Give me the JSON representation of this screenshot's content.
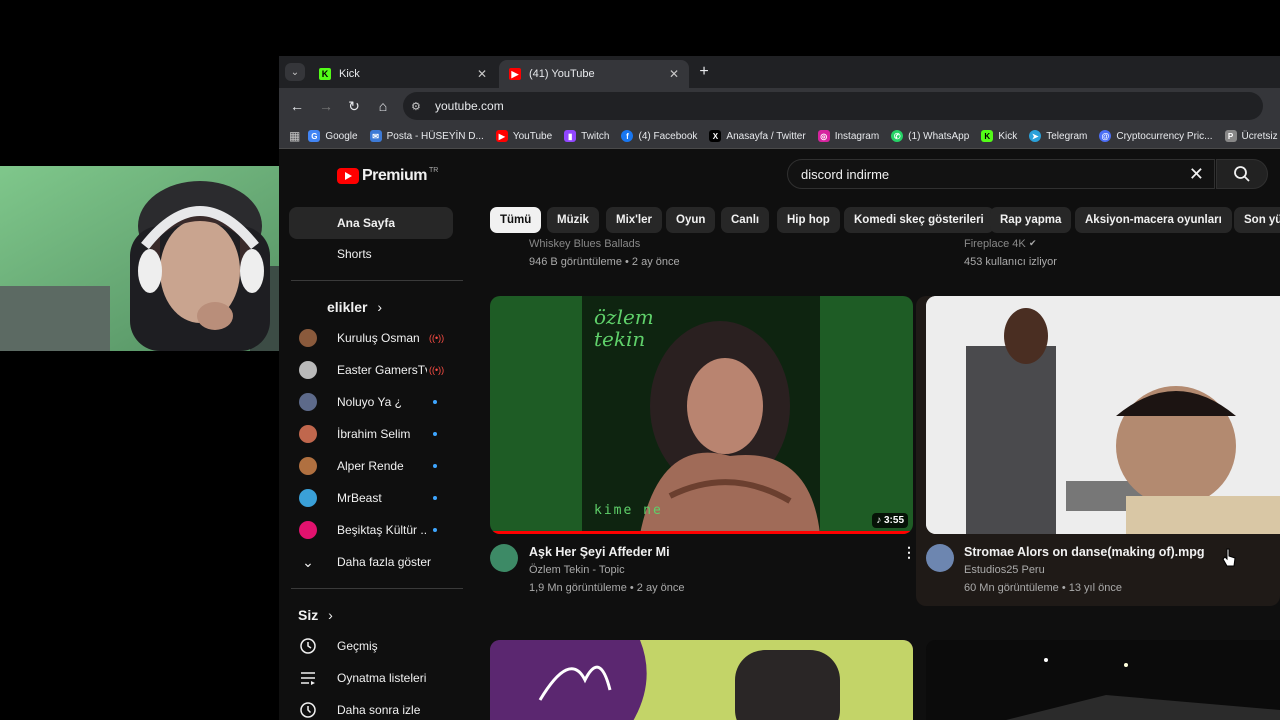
{
  "tabs": [
    {
      "title": "Kick",
      "favicon": "kick-icon",
      "active": false
    },
    {
      "title": "(41) YouTube",
      "favicon": "youtube-icon",
      "active": true
    }
  ],
  "address": {
    "url": "youtube.com"
  },
  "bookmarks": [
    {
      "label": "Google",
      "icon": "google-icon",
      "color": "#4285f4"
    },
    {
      "label": "Posta - HÜSEYİN D...",
      "icon": "mail-icon",
      "color": "#3d7ad6"
    },
    {
      "label": "YouTube",
      "icon": "youtube-icon",
      "color": "#ff0000"
    },
    {
      "label": "Twitch",
      "icon": "twitch-icon",
      "color": "#9146ff"
    },
    {
      "label": "(4) Facebook",
      "icon": "facebook-icon",
      "color": "#1877f2"
    },
    {
      "label": "Anasayfa / Twitter",
      "icon": "x-icon",
      "color": "#000000"
    },
    {
      "label": "Instagram",
      "icon": "instagram-icon",
      "color": "#d6249f"
    },
    {
      "label": "(1) WhatsApp",
      "icon": "whatsapp-icon",
      "color": "#25d366"
    },
    {
      "label": "Kick",
      "icon": "kick-icon",
      "color": "#53fc18"
    },
    {
      "label": "Telegram",
      "icon": "telegram-icon",
      "color": "#2aa1da"
    },
    {
      "label": "Cryptocurrency Pric...",
      "icon": "crypto-icon",
      "color": "#4c6ef5"
    },
    {
      "label": "Ücretsiz",
      "icon": "pin-icon",
      "color": "#888888"
    }
  ],
  "youtube": {
    "logo_text": "Premium",
    "logo_region": "TR",
    "search_query": "discord indirme"
  },
  "sidebar": {
    "main": [
      {
        "label": "Ana Sayfa",
        "icon": "home-icon"
      },
      {
        "label": "Shorts",
        "icon": "shorts-icon"
      }
    ],
    "subscriptions_title": "elikler",
    "subscriptions": [
      {
        "label": "Kuruluş Osman",
        "status": "live",
        "color": "#8a5a3c"
      },
      {
        "label": "Easter GamersTv",
        "status": "live",
        "color": "#b9b9b9"
      },
      {
        "label": "Noluyo Ya ¿",
        "status": "new",
        "color": "#5d6a8a"
      },
      {
        "label": "İbrahim Selim",
        "status": "new",
        "color": "#c0674d"
      },
      {
        "label": "Alper Rende",
        "status": "new",
        "color": "#b07040"
      },
      {
        "label": "MrBeast",
        "status": "new",
        "color": "#3aa0d8"
      },
      {
        "label": "Beşiktaş Kültür ...",
        "status": "new",
        "color": "#e2126e"
      }
    ],
    "show_more": "Daha fazla göster",
    "you_title": "Siz",
    "you_items": [
      {
        "label": "Geçmiş",
        "icon": "history-icon"
      },
      {
        "label": "Oynatma listeleri",
        "icon": "playlist-icon"
      },
      {
        "label": "Daha sonra izle",
        "icon": "watch-later-icon"
      }
    ]
  },
  "chips": [
    "Tümü",
    "Müzik",
    "Mix'ler",
    "Oyun",
    "Canlı",
    "Hip hop",
    "Komedi skeç gösterileri",
    "Rap yapma",
    "Aksiyon-macera oyunları",
    "Son yükl"
  ],
  "selected_chip": "Tümü",
  "prev_row": [
    {
      "channel": "Whiskey Blues Ballads",
      "meta": "946 B görüntüleme • 2 ay önce"
    },
    {
      "channel": "Fireplace 4K",
      "meta": "453 kullanıcı izliyor"
    }
  ],
  "videos": [
    {
      "title": "Aşk Her Şeyi Affeder Mi",
      "channel": "Özlem Tekin - Topic",
      "meta": "1,9 Mn görüntüleme • 2 ay önce",
      "duration": "3:55",
      "thumb_text_top": "özlem tekin",
      "thumb_text_bottom": "kime ne",
      "watched_fraction": 1.0
    },
    {
      "title": "Stromae   Alors on danse(making of).mpg",
      "channel": "Estudios25 Peru",
      "meta": "60 Mn görüntüleme • 13 yıl önce"
    }
  ]
}
